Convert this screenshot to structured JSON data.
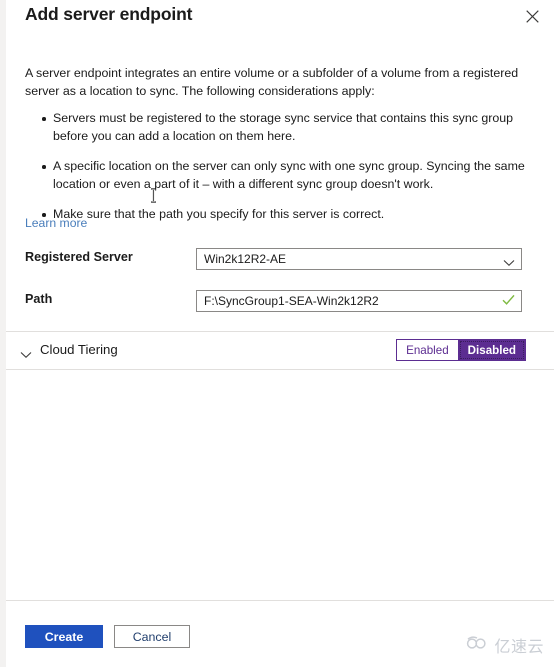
{
  "blade": {
    "title": "Add server endpoint",
    "close_icon": "close-icon"
  },
  "intro": "A server endpoint integrates an entire volume or a subfolder of a volume from a registered server as a location to sync. The following considerations apply:",
  "bullets": [
    "Servers must be registered to the storage sync service that contains this sync group before you can add a location on them here.",
    "A specific location on the server can only sync with one sync group. Syncing the same location or even a part of it – with a different sync group doesn't work.",
    "Make sure that the path you specify for this server is correct."
  ],
  "learn_more": "Learn more",
  "form": {
    "registered_server": {
      "label": "Registered Server",
      "value": "Win2k12R2-AE",
      "icon": "chevron-down-icon"
    },
    "path": {
      "label": "Path",
      "value": "F:\\SyncGroup1-SEA-Win2k12R2",
      "placeholder": "",
      "icon": "checkmark-icon"
    }
  },
  "cloud_tiering": {
    "title": "Cloud Tiering",
    "expand_icon": "chevron-down-icon",
    "options": [
      "Enabled",
      "Disabled"
    ],
    "selected": "Disabled"
  },
  "footer": {
    "create_label": "Create",
    "cancel_label": "Cancel"
  },
  "watermark": {
    "text": "亿速云",
    "icon": "cloud-logo-icon"
  },
  "colors": {
    "primary_button": "#1f51be",
    "accent_purple": "#5c2d91",
    "link_blue": "#4a7ebb",
    "success_green": "#7fba42",
    "border_gray": "#8a8886"
  }
}
